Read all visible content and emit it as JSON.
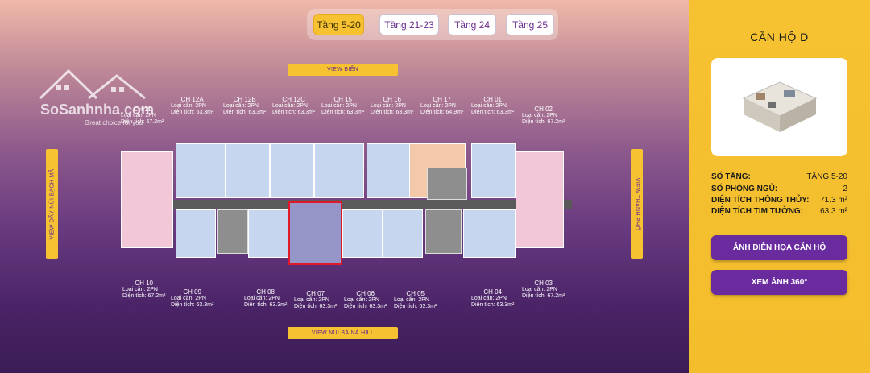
{
  "tabs": [
    {
      "label": "Tầng 5-20",
      "active": true
    },
    {
      "label": "Tầng 21-23",
      "active": false
    },
    {
      "label": "Tầng 24",
      "active": false
    },
    {
      "label": "Tầng 25",
      "active": false
    }
  ],
  "views": {
    "top": "VIEW BIỂN",
    "bottom": "VIEW NÚI BÀ NÀ HILL",
    "left": "VIEW DÃY NÚI BẠCH MÃ",
    "right": "VIEW THÀNH PHỐ"
  },
  "watermark": {
    "name": "SoSanhnha.com",
    "tagline": "Great choice for you"
  },
  "units_top": [
    {
      "name": "CH 11",
      "type": "Loại căn: 2PN",
      "area": "Diện tích: 67.2m²"
    },
    {
      "name": "CH 12A",
      "type": "Loại căn: 2PN",
      "area": "Diện tích: 63.3m²"
    },
    {
      "name": "CH 12B",
      "type": "Loại căn: 2PN",
      "area": "Diện tích: 63.3m²"
    },
    {
      "name": "CH 12C",
      "type": "Loại căn: 2PN",
      "area": "Diện tích: 63.3m²"
    },
    {
      "name": "CH 15",
      "type": "Loại căn: 2PN",
      "area": "Diện tích: 63.3m²"
    },
    {
      "name": "CH 16",
      "type": "Loại căn: 2PN",
      "area": "Diện tích: 63.3m²"
    },
    {
      "name": "CH 17",
      "type": "Loại căn: 2PN",
      "area": "Diện tích: 64.9m²"
    },
    {
      "name": "CH 01",
      "type": "Loại căn: 2PN",
      "area": "Diện tích: 63.3m²"
    },
    {
      "name": "CH 02",
      "type": "Loại căn: 2PN",
      "area": "Diện tích: 67.2m²"
    }
  ],
  "units_bottom": [
    {
      "name": "CH 10",
      "type": "Loại căn: 2PN",
      "area": "Diện tích: 67.2m²"
    },
    {
      "name": "CH 09",
      "type": "Loại căn: 2PN",
      "area": "Diện tích: 63.3m²"
    },
    {
      "name": "CH 08",
      "type": "Loại căn: 2PN",
      "area": "Diện tích: 63.3m²"
    },
    {
      "name": "CH 07",
      "type": "Loại căn: 2PN",
      "area": "Diện tích: 63.3m²"
    },
    {
      "name": "CH 06",
      "type": "Loại căn: 2PN",
      "area": "Diện tích: 63.3m²"
    },
    {
      "name": "CH 05",
      "type": "Loại căn: 2PN",
      "area": "Diện tích: 63.3m²"
    },
    {
      "name": "CH 04",
      "type": "Loại căn: 2PN",
      "area": "Diện tích: 63.3m²"
    },
    {
      "name": "CH 03",
      "type": "Loại căn: 2PN",
      "area": "Diện tích: 67.2m²"
    }
  ],
  "panel": {
    "title": "CĂN HỘ D",
    "rows": [
      {
        "label": "SỐ TẦNG:",
        "value": "TẦNG 5-20"
      },
      {
        "label": "SỐ PHÒNG NGỦ:",
        "value": "2"
      },
      {
        "label": "DIỆN TÍCH THÔNG THỦY:",
        "value": "71.3 m²"
      },
      {
        "label": "DIỆN TÍCH TIM TƯỜNG:",
        "value": "63.3 m²"
      }
    ],
    "btn_render": "ẢNH DIỄN HỌA CĂN HỘ",
    "btn_360": "XEM ẢNH 360°"
  },
  "colors": {
    "accent": "#f6c232",
    "brand_purple": "#6a2b9f",
    "selected_outline": "#e0182a"
  }
}
